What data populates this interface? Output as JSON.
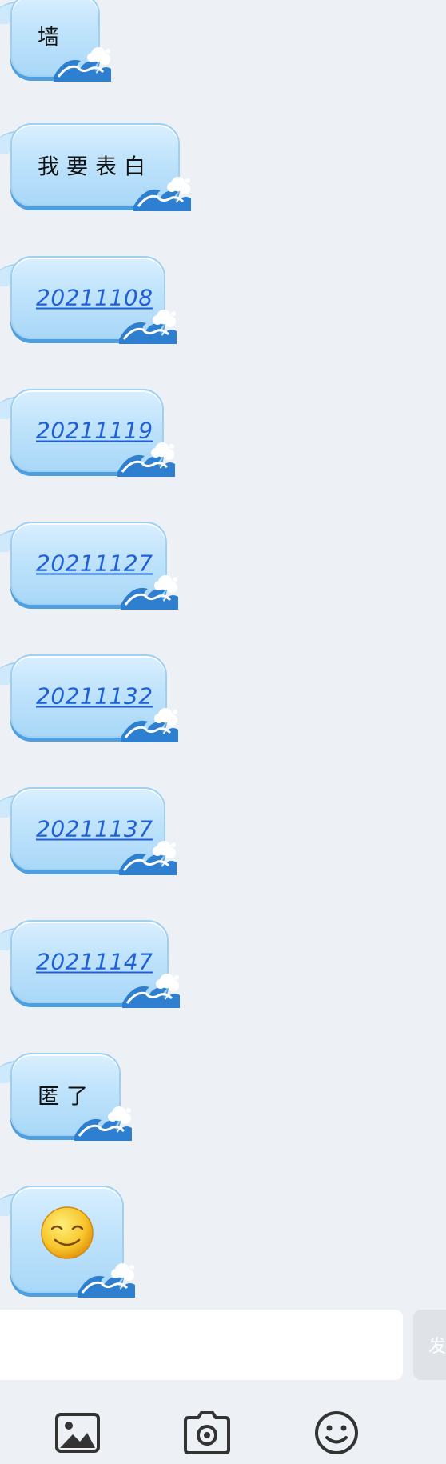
{
  "chat": {
    "messages": [
      {
        "kind": "text",
        "text": "墙"
      },
      {
        "kind": "text",
        "text": "我要表白"
      },
      {
        "kind": "link",
        "text": "20211108"
      },
      {
        "kind": "link",
        "text": "20211119"
      },
      {
        "kind": "link",
        "text": "20211127"
      },
      {
        "kind": "link",
        "text": "20211132"
      },
      {
        "kind": "link",
        "text": "20211137"
      },
      {
        "kind": "link",
        "text": "20211147"
      },
      {
        "kind": "text",
        "text": "匿了"
      },
      {
        "kind": "emoji",
        "emoji": "smiling-face-icon"
      }
    ]
  },
  "composer": {
    "input_value": "",
    "send_label": "发"
  },
  "toolbar": {
    "icons": [
      "image-icon",
      "camera-icon",
      "emoji-icon"
    ]
  },
  "colors": {
    "background": "#edf1f6",
    "bubble_fill": "#bfe3fb",
    "bubble_shadow": "#4d9fe0",
    "link": "#1f5fd8",
    "icon": "#333333"
  }
}
